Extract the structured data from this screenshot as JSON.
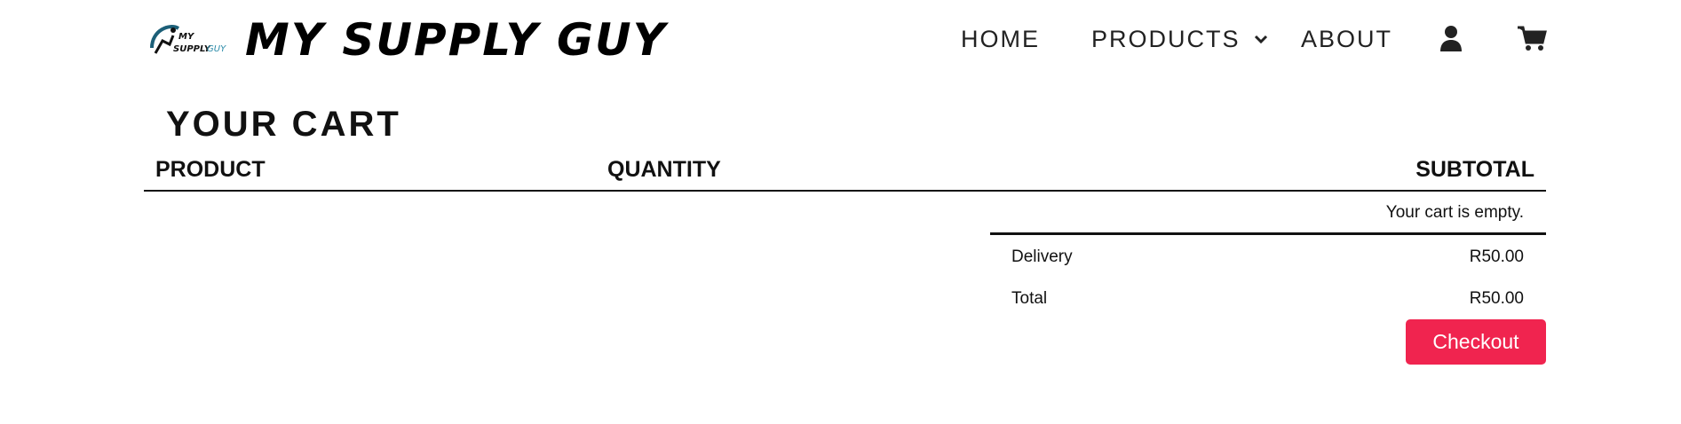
{
  "brand": {
    "logo_icon": "runner-logo-icon",
    "name": "MY SUPPLY GUY"
  },
  "nav": {
    "home": "HOME",
    "products": "PRODUCTS",
    "about": "ABOUT",
    "products_icon": "chevron-down-icon",
    "user_icon": "user-icon",
    "cart_icon": "cart-icon"
  },
  "cart": {
    "title": "YOUR CART",
    "columns": [
      "PRODUCT",
      "QUANTITY",
      "SUBTOTAL"
    ],
    "empty_message": "Your cart is empty.",
    "summary": [
      {
        "label": "Delivery",
        "value": "R50.00"
      },
      {
        "label": "Total",
        "value": "R50.00"
      }
    ],
    "checkout_label": "Checkout"
  },
  "colors": {
    "accent": "#f0244f",
    "text": "#111111",
    "logo_teal": "#2a8aa8"
  }
}
